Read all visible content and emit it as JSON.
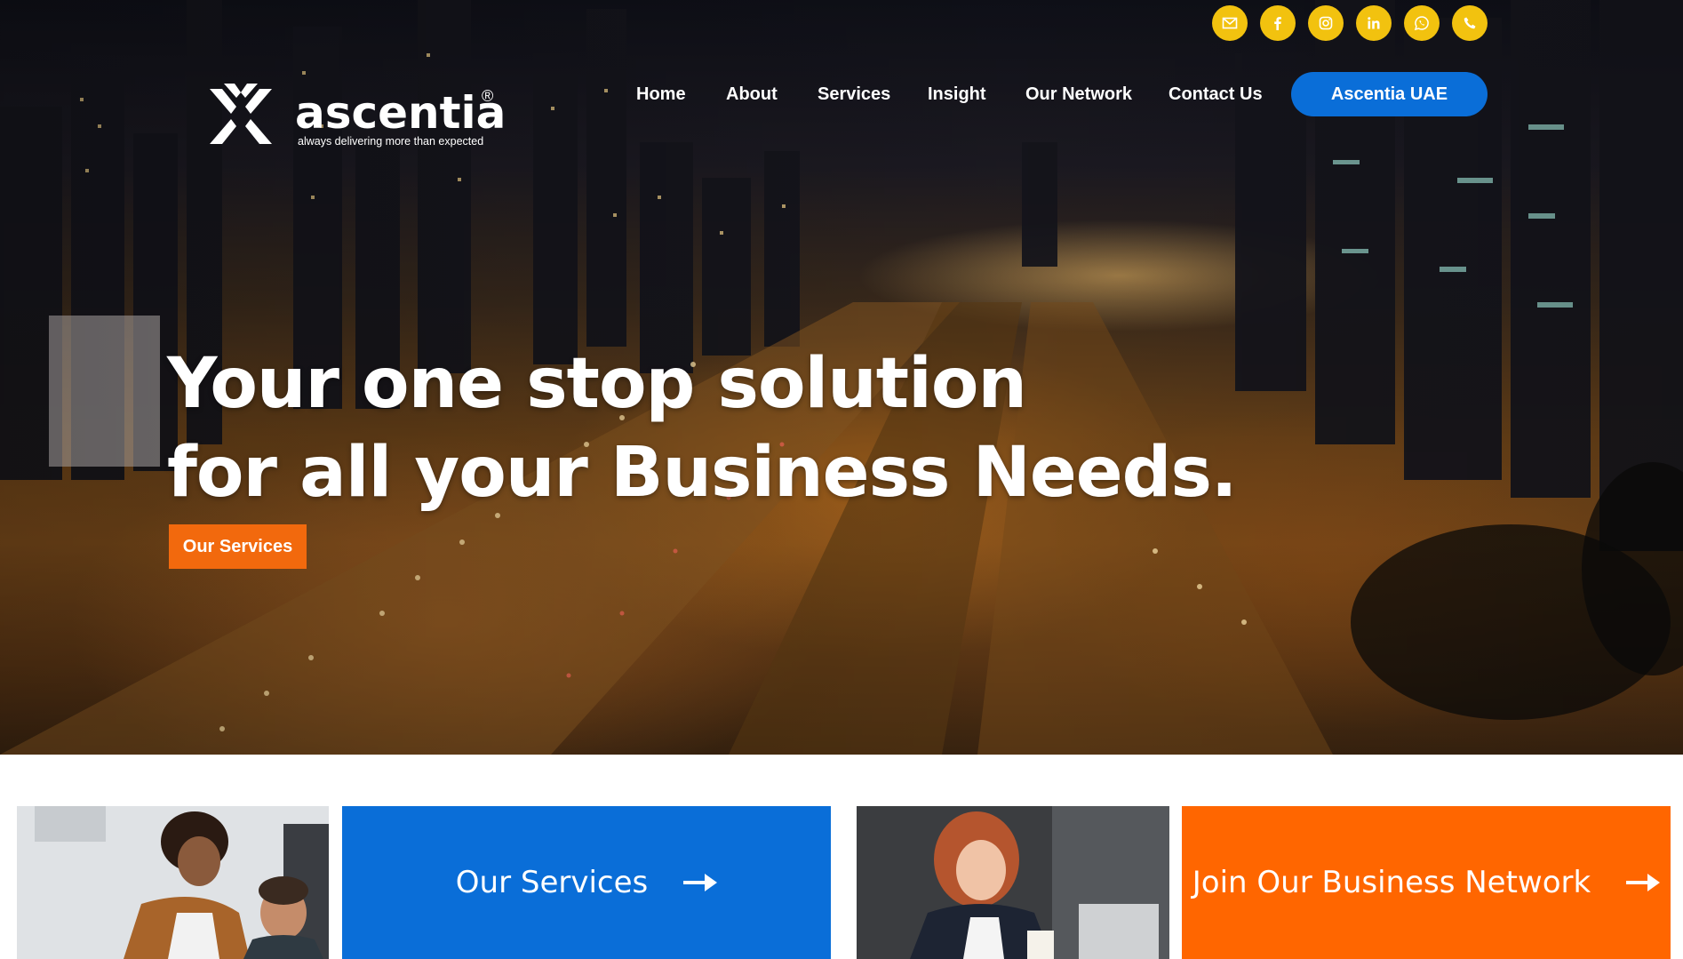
{
  "social": {
    "icons": [
      "mail-icon",
      "facebook-icon",
      "instagram-icon",
      "linkedin-icon",
      "whatsapp-icon",
      "phone-icon"
    ],
    "color": "#f2c20f"
  },
  "brand": {
    "name": "ascentia",
    "registered": "®",
    "tagline": "always delivering more than expected"
  },
  "nav": {
    "items": [
      "Home",
      "About",
      "Services",
      "Insight",
      "Our Network",
      "Contact Us"
    ],
    "cta_label": "Ascentia UAE",
    "cta_color": "#0a6ed8"
  },
  "hero": {
    "headline_line1": "Your one stop solution",
    "headline_line2": "for all your Business Needs.",
    "cta_label": "Our Services",
    "cta_color": "#f2690d"
  },
  "cards": {
    "services_label": "Our Services",
    "network_label": "Join Our Business Network",
    "services_color": "#0a6ed8",
    "network_color": "#ff6600"
  }
}
